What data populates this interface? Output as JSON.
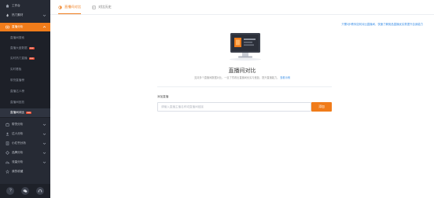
{
  "sidebar": {
    "items": [
      {
        "label": "工作台",
        "icon": "home-icon"
      },
      {
        "label": "热门素材",
        "icon": "flame-icon"
      },
      {
        "label": "直播分析",
        "icon": "live-analysis-icon"
      },
      {
        "label": "带货分析",
        "icon": "goods-icon"
      },
      {
        "label": "达人分析",
        "icon": "user-icon"
      },
      {
        "label": "小红书分析",
        "icon": "note-icon"
      },
      {
        "label": "品牌分析",
        "icon": "brand-icon"
      },
      {
        "label": "流量分析",
        "icon": "chart-icon"
      },
      {
        "label": "我的收藏",
        "icon": "star-icon"
      }
    ],
    "sub_items": [
      {
        "label": "直播间搜索",
        "badge": ""
      },
      {
        "label": "直播大盘数据",
        "badge": "new"
      },
      {
        "label": "实时热门直播",
        "badge": "new"
      },
      {
        "label": "实时看板",
        "badge": ""
      },
      {
        "label": "带货直播榜",
        "badge": ""
      },
      {
        "label": "直播达人榜",
        "badge": ""
      },
      {
        "label": "直播间回放",
        "badge": ""
      },
      {
        "label": "直播间对比",
        "badge": "new"
      }
    ],
    "footer_icons": [
      "help-icon",
      "wechat-icon",
      "service-icon"
    ]
  },
  "tabs": [
    {
      "label": "直播间对比",
      "active": true
    },
    {
      "label": "对比历史",
      "active": false
    }
  ],
  "help_link": "只需3步教你如何对比直播间，快速了解竞品直播优劣势提升自身能力",
  "main": {
    "title": "直播间对比",
    "description": "支持多个直播间数据对比，一目了然看出直播间优劣与差距，提升直播能力。",
    "description_link": "查看示例"
  },
  "search": {
    "label": "添加直播",
    "placeholder": "请输入直播主播名称或直播间链接",
    "value": "",
    "button": "添加"
  },
  "colors": {
    "accent": "#f07c1a",
    "sidebar_bg": "#262a34",
    "link": "#3a8ee6"
  }
}
